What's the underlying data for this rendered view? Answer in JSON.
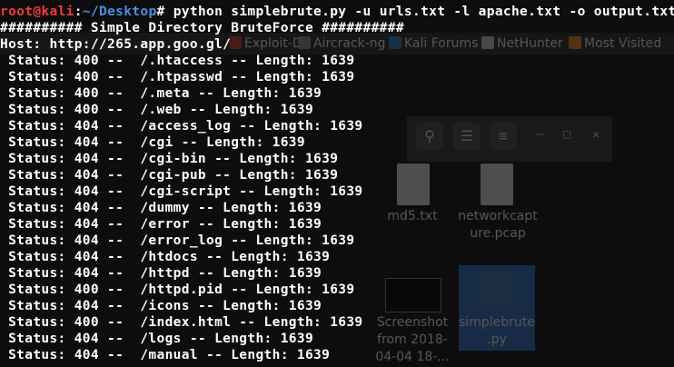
{
  "background": {
    "bookmarks": [
      {
        "label": "Exploit-DB",
        "icon": "exploit-db-icon",
        "color": "#c0392b"
      },
      {
        "label": "Aircrack-ng",
        "icon": "aircrack-icon",
        "color": "#7f8c8d"
      },
      {
        "label": "Kali Forums",
        "icon": "kali-forums-icon",
        "color": "#2980b9"
      },
      {
        "label": "NetHunter",
        "icon": "nethunter-icon",
        "color": "#bdc3c7"
      },
      {
        "label": "Most Visited",
        "icon": "folder-icon",
        "color": "#e67e22"
      }
    ],
    "file_manager": {
      "search_icon": "search-icon",
      "view_icon": "list-view-icon",
      "menu_icon": "hamburger-menu-icon",
      "files": [
        {
          "name_line1": "md5.txt",
          "name_line2": ""
        },
        {
          "name_line1": "networkcapt",
          "name_line2": "ure.pcap"
        },
        {
          "name_line1": "Screenshot",
          "name_line2": "from 2018-"
        },
        {
          "name_line1": "simplebrute",
          "name_line2": ".py"
        }
      ],
      "screenshot_line3": "04-04 18-..."
    }
  },
  "terminal": {
    "prompt_user": "root@kali",
    "prompt_sep": ":",
    "prompt_path": "~/Desktop",
    "prompt_symbol": "#",
    "command": " python simplebrute.py -u urls.txt -l apache.txt -o output.txt",
    "banner": "########## Simple Directory BruteForce ##########",
    "host_line": "Host: http://265.app.goo.gl/",
    "results": [
      {
        "status": "400",
        "path": "/.htaccess",
        "length": "1639"
      },
      {
        "status": "400",
        "path": "/.htpasswd",
        "length": "1639"
      },
      {
        "status": "400",
        "path": "/.meta",
        "length": "1639"
      },
      {
        "status": "400",
        "path": "/.web",
        "length": "1639"
      },
      {
        "status": "404",
        "path": "/access_log",
        "length": "1639"
      },
      {
        "status": "404",
        "path": "/cgi",
        "length": "1639"
      },
      {
        "status": "404",
        "path": "/cgi-bin",
        "length": "1639"
      },
      {
        "status": "404",
        "path": "/cgi-pub",
        "length": "1639"
      },
      {
        "status": "404",
        "path": "/cgi-script",
        "length": "1639"
      },
      {
        "status": "404",
        "path": "/dummy",
        "length": "1639"
      },
      {
        "status": "404",
        "path": "/error",
        "length": "1639"
      },
      {
        "status": "404",
        "path": "/error_log",
        "length": "1639"
      },
      {
        "status": "404",
        "path": "/htdocs",
        "length": "1639"
      },
      {
        "status": "404",
        "path": "/httpd",
        "length": "1639"
      },
      {
        "status": "400",
        "path": "/httpd.pid",
        "length": "1639"
      },
      {
        "status": "404",
        "path": "/icons",
        "length": "1639"
      },
      {
        "status": "400",
        "path": "/index.html",
        "length": "1639"
      },
      {
        "status": "404",
        "path": "/logs",
        "length": "1639"
      },
      {
        "status": "404",
        "path": "/manual",
        "length": "1639"
      }
    ]
  }
}
